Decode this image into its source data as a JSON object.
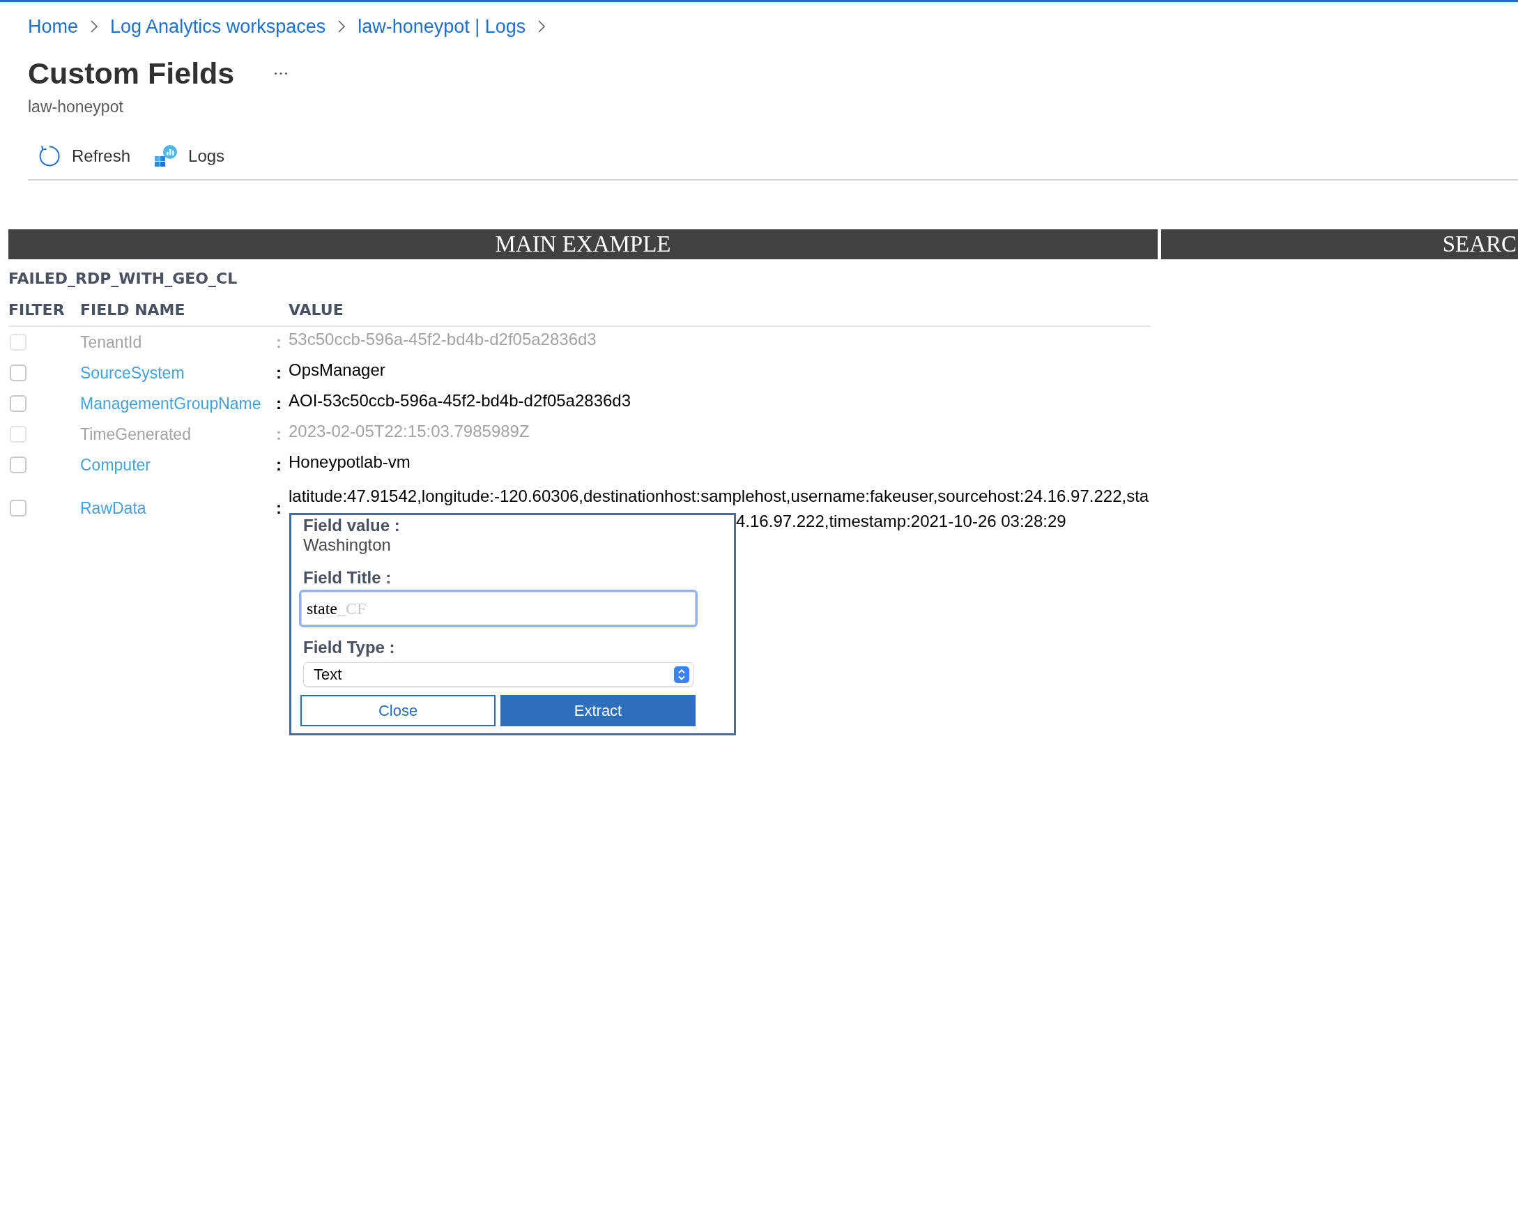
{
  "breadcrumb": [
    {
      "label": "Home"
    },
    {
      "label": "Log Analytics workspaces"
    },
    {
      "label": "law-honeypot | Logs"
    }
  ],
  "page": {
    "title": "Custom Fields",
    "subtitle": "law-honeypot"
  },
  "toolbar": [
    {
      "label": "Refresh",
      "kind": "refresh"
    },
    {
      "label": "Logs",
      "kind": "logs"
    }
  ],
  "section_headers": [
    {
      "title": "MAIN EXAMPLE"
    },
    {
      "title": "SEARC"
    }
  ],
  "table": {
    "name": "FAILED_RDP_WITH_GEO_CL",
    "columns": [
      "FILTER",
      "FIELD NAME",
      "VALUE"
    ],
    "rows": [
      {
        "name": "TenantId",
        "separator": ":",
        "value": "53c50ccb-596a-45f2-bd4b-d2f05a2836d3",
        "disabled": true,
        "checked": false
      },
      {
        "name": "SourceSystem",
        "separator": ":",
        "value": "OpsManager",
        "disabled": false,
        "checked": false
      },
      {
        "name": "ManagementGroupName",
        "separator": ":",
        "value": "AOI-53c50ccb-596a-45f2-bd4b-d2f05a2836d3",
        "disabled": false,
        "checked": false
      },
      {
        "name": "TimeGenerated",
        "separator": ":",
        "value": "2023-02-05T22:15:03.7985989Z",
        "disabled": true,
        "checked": false
      },
      {
        "name": "Computer",
        "separator": ":",
        "value": "Honeypotlab-vm",
        "disabled": false,
        "checked": false
      },
      {
        "name": "RawData",
        "separator": ":",
        "value": "latitude:47.91542,longitude:-120.60306,destinationhost:samplehost,username:fakeuser,sourcehost:24.16.97.222,sta",
        "value_continued": "4.16.97.222,timestamp:2021-10-26 03:28:29",
        "disabled": false,
        "checked": false
      }
    ]
  },
  "popup": {
    "value_label": "Field value :",
    "value": "Washington",
    "title_label": "Field Title :",
    "title_input": {
      "value": "state",
      "suffix": "_CF"
    },
    "type_label": "Field Type :",
    "type_select": {
      "value": "Text"
    },
    "buttons": [
      {
        "label": "Close",
        "kind": "secondary"
      },
      {
        "label": "Extract",
        "kind": "primary"
      }
    ]
  }
}
